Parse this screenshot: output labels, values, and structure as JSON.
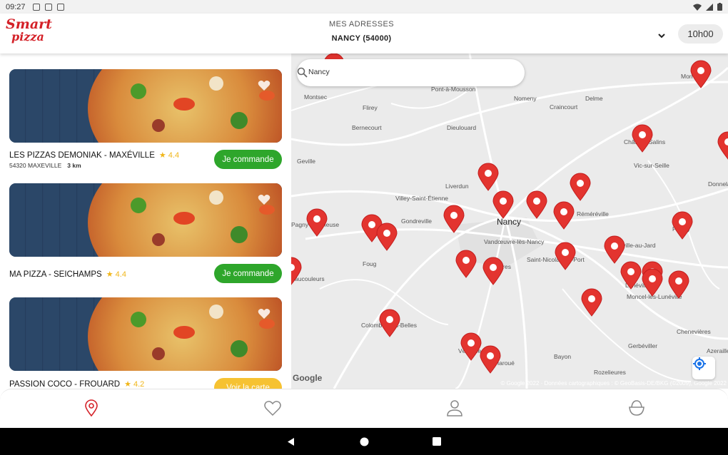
{
  "status_bar": {
    "time": "09:27"
  },
  "header": {
    "logo_line1": "Smart",
    "logo_line2": "pizza",
    "address_label": "MES ADRESSES",
    "address_value": "NANCY (54000)",
    "time_chip": "10h00"
  },
  "restaurants": [
    {
      "name": "LES PIZZAS DEMONIAK - MAXÉVILLE",
      "rating": "4.4",
      "address": "54320 MAXEVILLE",
      "distance": "3 km",
      "button": "Je commande"
    },
    {
      "name": "MA PIZZA - SEICHAMPS",
      "rating": "4.4",
      "button": "Je commande"
    },
    {
      "name": "PASSION COCO - FROUARD",
      "rating": "4.2",
      "button": "Voir la carte"
    }
  ],
  "map": {
    "search_value": "Nancy",
    "google_label": "Google",
    "attribution": "© Google 2022 · Données cartographiques : © GeoBasis-DE/BKG (©2009), Google 2022",
    "places": [
      {
        "name": "Pont-à-Mousson"
      },
      {
        "name": "Montsec"
      },
      {
        "name": "Flirey"
      },
      {
        "name": "Nomeny"
      },
      {
        "name": "Delme"
      },
      {
        "name": "Morhange"
      },
      {
        "name": "Craincourt"
      },
      {
        "name": "Bernecourt"
      },
      {
        "name": "Dieulouard"
      },
      {
        "name": "Château-Salins"
      },
      {
        "name": "Geville"
      },
      {
        "name": "Vic-sur-Seille"
      },
      {
        "name": "Liverdun"
      },
      {
        "name": "Donnelay"
      },
      {
        "name": "Villey-Saint-Étienne"
      },
      {
        "name": "Réméréville"
      },
      {
        "name": "Pagny-sur-Meuse"
      },
      {
        "name": "Gondreville"
      },
      {
        "name": "Nancy"
      },
      {
        "name": "Parroy"
      },
      {
        "name": "Vandœuvre-lès-Nancy"
      },
      {
        "name": "Saint-Nicolas-de-Port"
      },
      {
        "name": "Einville-au-Jard"
      },
      {
        "name": "Foug"
      },
      {
        "name": "Vaucouleurs"
      },
      {
        "name": "Lunéville"
      },
      {
        "name": "Ludres"
      },
      {
        "name": "Moncel-lès-Lunéville"
      },
      {
        "name": "Colombey-les-Belles"
      },
      {
        "name": "Chenevières"
      },
      {
        "name": "Vézelise"
      },
      {
        "name": "Haroué"
      },
      {
        "name": "Gerbéviller"
      },
      {
        "name": "Bayon"
      },
      {
        "name": "Azerailles"
      },
      {
        "name": "Rozelieures"
      }
    ]
  },
  "bottom_nav": [
    "map-pin",
    "heart",
    "user",
    "basket"
  ],
  "colors": {
    "brand": "#d42128",
    "order_green": "#2ea62b",
    "rating": "#f0b61a",
    "pin": "#e3342f"
  }
}
